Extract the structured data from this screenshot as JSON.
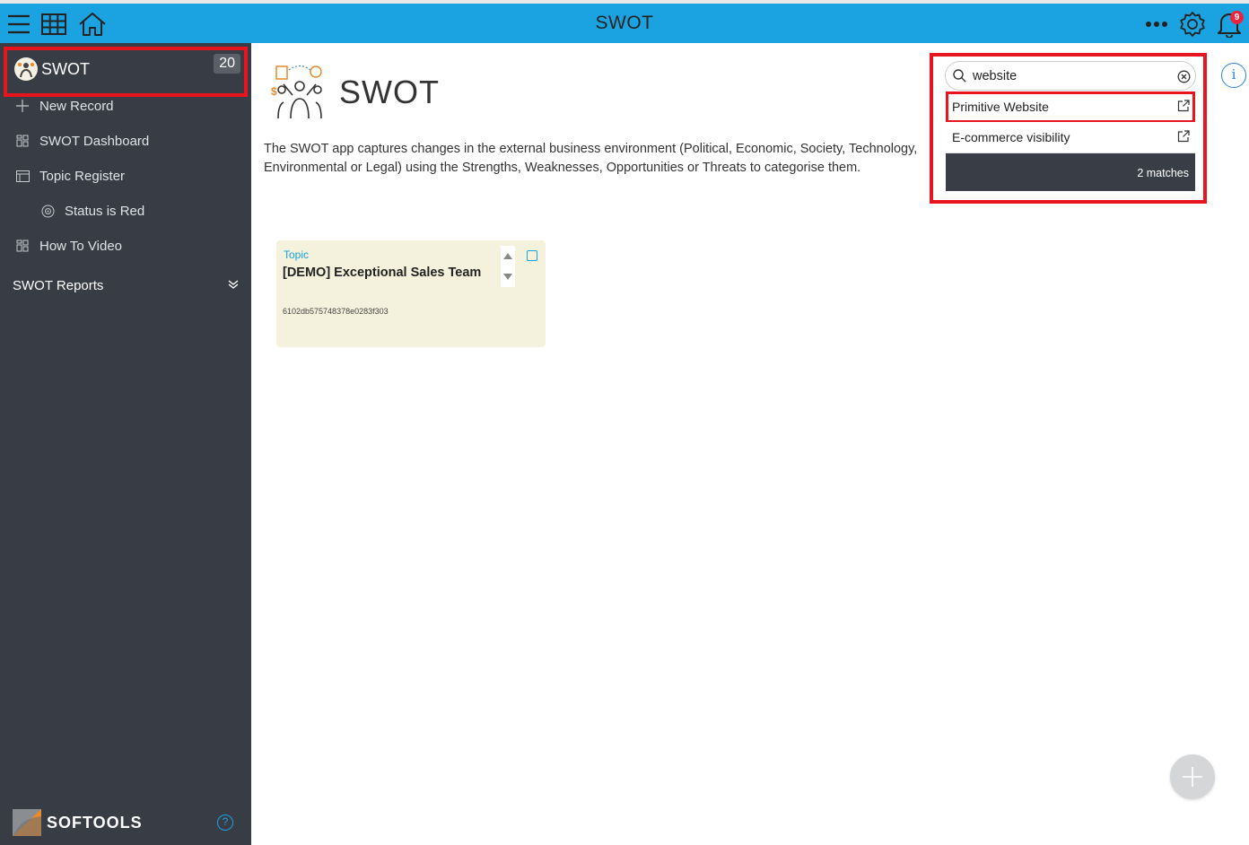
{
  "topbar": {
    "title": "SWOT",
    "notification_count": "9",
    "icons": [
      "menu-icon",
      "grid-icon",
      "home-icon",
      "more-icon",
      "settings-icon",
      "bell-icon"
    ]
  },
  "sidebar": {
    "app_name": "SWOT",
    "app_count": "20",
    "items": [
      {
        "label": "New Record",
        "icon": "plus-icon"
      },
      {
        "label": "SWOT Dashboard",
        "icon": "dashboard-icon"
      },
      {
        "label": "Topic Register",
        "icon": "register-icon"
      },
      {
        "label": "Status is Red",
        "icon": "target-icon"
      },
      {
        "label": "How To Video",
        "icon": "dashboard-icon"
      }
    ],
    "reports_label": "SWOT Reports",
    "brand": "SOFTOOLS",
    "help": "?"
  },
  "main": {
    "title": "SWOT",
    "description": "The SWOT app captures changes in the external business environment (Political, Economic, Society, Technology, Environmental or Legal) using the Strengths, Weaknesses, Opportunities or Threats to categorise them.",
    "card": {
      "label": "Topic",
      "title": "[DEMO] Exceptional Sales Team",
      "id": "6102db575748378e0283f303"
    }
  },
  "search": {
    "value": "website",
    "results": [
      "Primitive Website",
      "E-commerce visibility"
    ],
    "matches": "2 matches"
  },
  "info": "i",
  "colors": {
    "topbar": "#1aa3e0",
    "sidebar": "#383c44",
    "highlight": "#e8151e",
    "card": "#f4f2dc"
  }
}
